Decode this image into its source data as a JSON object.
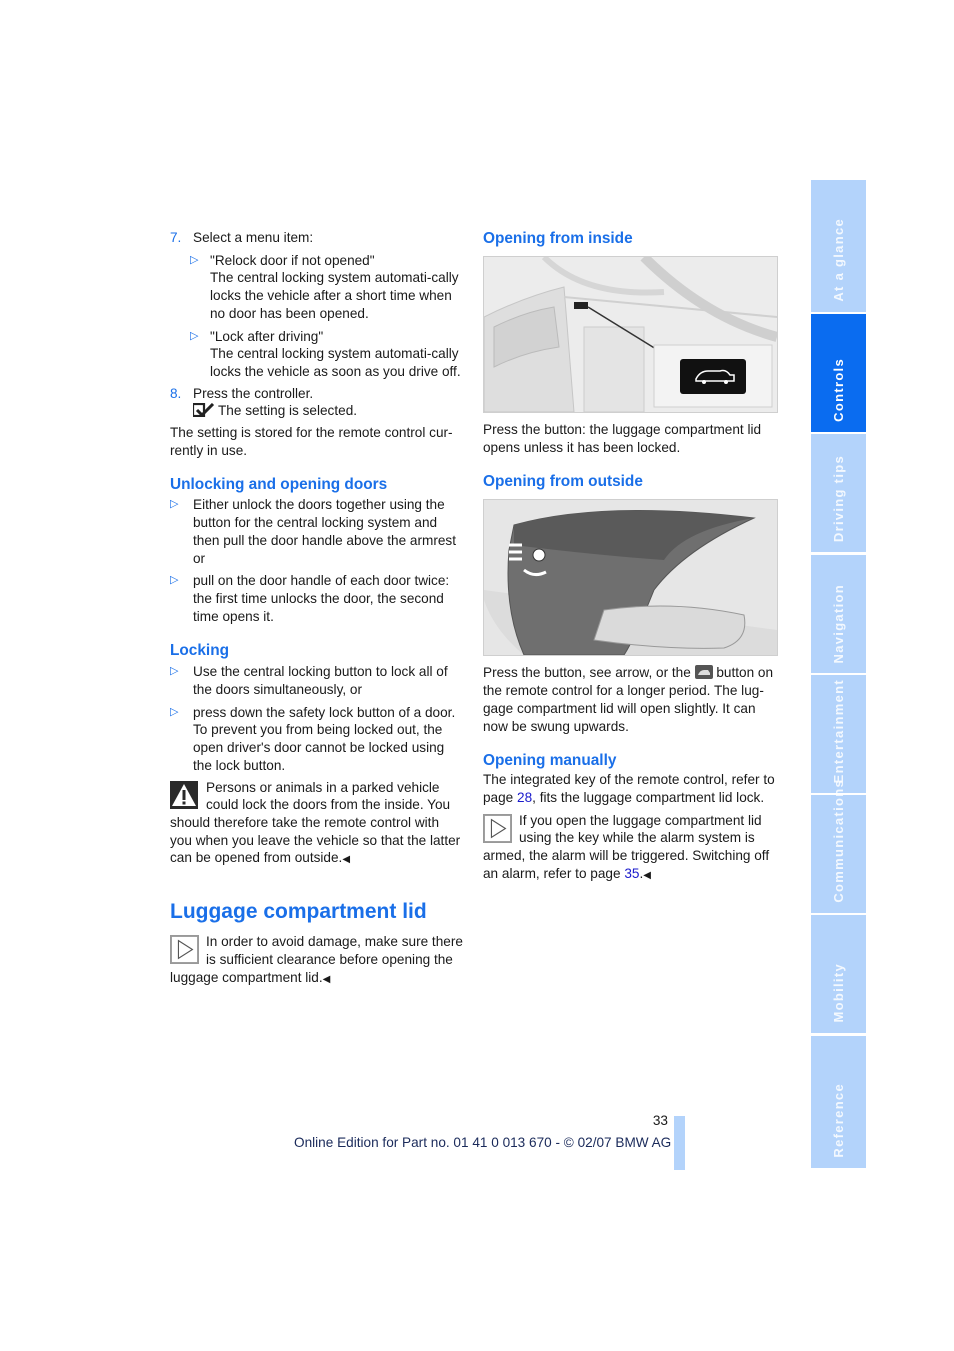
{
  "left_column": {
    "step7": {
      "number": "7.",
      "text": "Select a menu item:"
    },
    "step7_options": [
      {
        "title": "\"Relock door if not opened\"",
        "text": "The central locking system automati-cally locks the vehicle after a short time when no door has been opened."
      },
      {
        "title": "\"Lock after driving\"",
        "text": "The central locking system automati-cally locks the vehicle as soon as you drive off."
      }
    ],
    "step8": {
      "number": "8.",
      "text": "Press the controller."
    },
    "step8_result": "The setting is selected.",
    "stored_note": "The setting is stored for the remote control cur-rently in use.",
    "unlocking": {
      "heading": "Unlocking and opening doors",
      "bullets": [
        "Either unlock the doors together using the button for the central locking system and then pull the door handle above the armrest or",
        "pull on the door handle of each door twice: the first time unlocks the door, the second time opens it."
      ]
    },
    "locking": {
      "heading": "Locking",
      "bullets": [
        "Use the central locking button to lock all of the doors simultaneously, or",
        "press down the safety lock button of a door. To prevent you from being locked out, the open driver's door cannot be locked using the lock button."
      ]
    },
    "warning": "Persons or animals in a parked vehicle could lock the doors from the inside. You should therefore take the remote control with you when you leave the vehicle so that the latter can be opened from outside.",
    "luggage": {
      "heading": "Luggage compartment lid",
      "note": "In order to avoid damage, make sure there is sufficient clearance before opening the luggage compartment lid."
    },
    "end_mark": "◀"
  },
  "right_column": {
    "inside": {
      "heading": "Opening from inside",
      "caption": "Press the button: the luggage compartment lid opens unless it has been locked."
    },
    "outside": {
      "heading": "Opening from outside",
      "caption_before_icon": "Press the button, see arrow, or the",
      "caption_after_icon": "button on the remote control for a longer period. The lug-gage compartment lid will open slightly. It can now be swung upwards."
    },
    "manually": {
      "heading": "Opening manually",
      "text_before_link": "The integrated key of the remote control, refer to page",
      "link1": "28",
      "text_after_link": ", fits the luggage compartment lid lock.",
      "note_before_link": "If you open the luggage compartment lid using the key while the alarm system is armed, the alarm will be triggered. Switching off an alarm, refer to page",
      "link2": "35",
      "note_after_link": "."
    }
  },
  "thumb_index": {
    "tabs": [
      {
        "label": "At a glance",
        "active": false
      },
      {
        "label": "Controls",
        "active": true
      },
      {
        "label": "Driving tips",
        "active": false
      },
      {
        "label": "Navigation",
        "active": false
      },
      {
        "label": "Entertainment",
        "active": false
      },
      {
        "label": "Communications",
        "active": false
      },
      {
        "label": "Mobility",
        "active": false
      },
      {
        "label": "Reference",
        "active": false
      }
    ]
  },
  "footer": {
    "page_number": "33",
    "edition": "Online Edition for Part no. 01 41 0 013 670 - © 02/07 BMW AG"
  },
  "colors": {
    "accent": "#1a6fe8",
    "thumb_inactive": "#b3d3fb",
    "thumb_active": "#0a6cf0",
    "link": "#1a1acc"
  }
}
